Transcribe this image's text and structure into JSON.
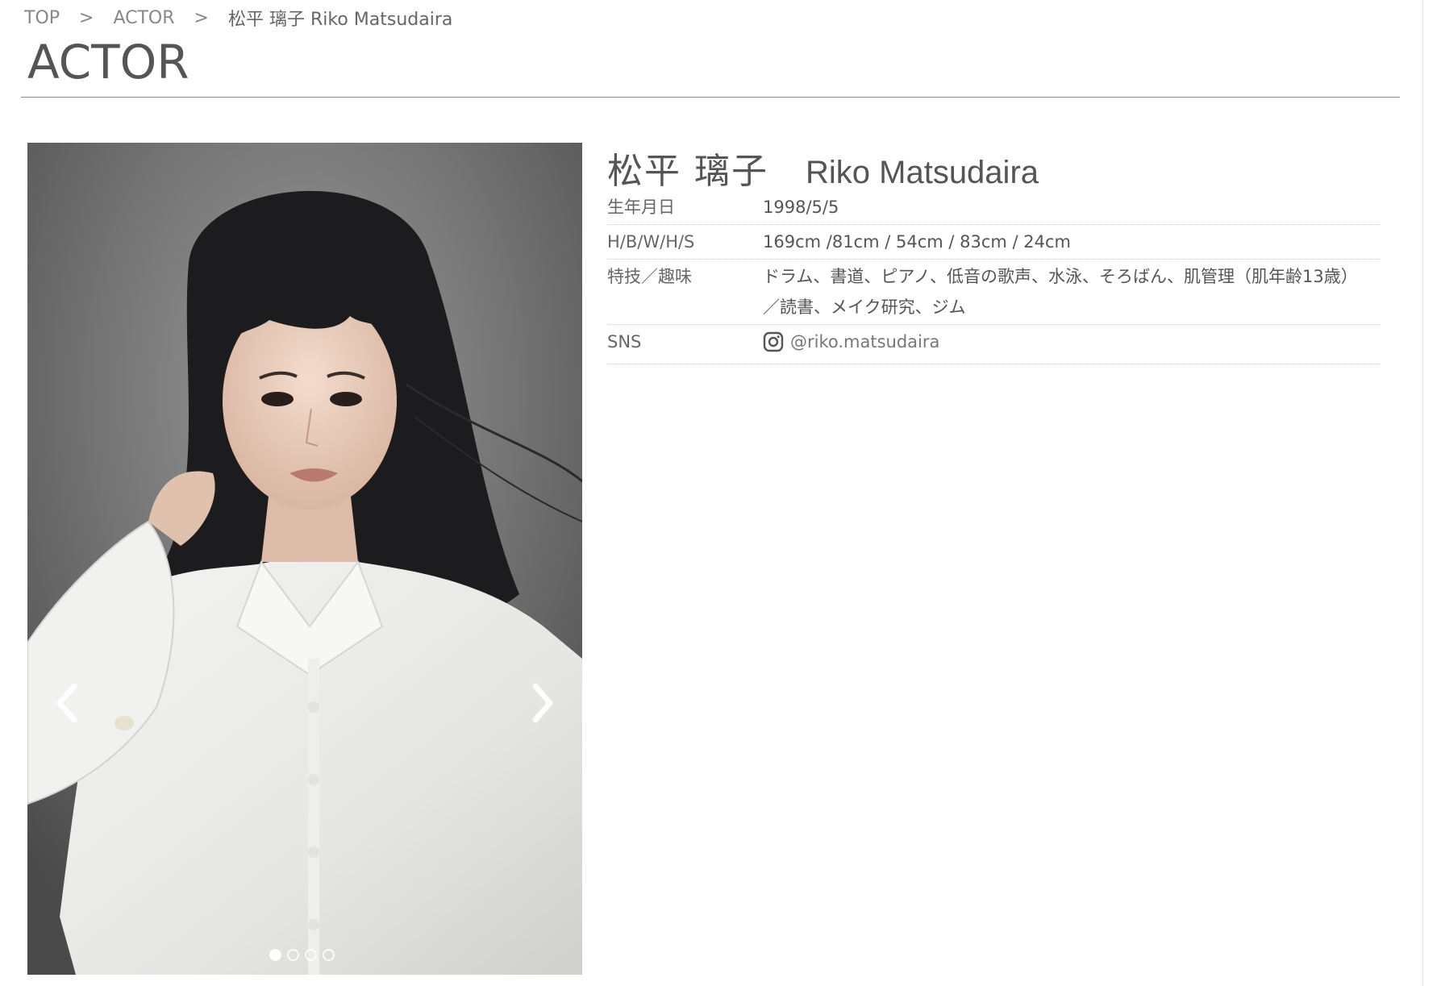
{
  "breadcrumb": {
    "items": [
      {
        "label": "TOP"
      },
      {
        "label": "ACTOR"
      },
      {
        "label": "松平 璃子 Riko Matsudaira"
      }
    ],
    "separator": ">"
  },
  "page_title": "ACTOR",
  "carousel": {
    "prev_icon": "chevron-left-icon",
    "next_icon": "chevron-right-icon",
    "slide_count": 4,
    "active_index": 0
  },
  "profile": {
    "name_jp": "松平 璃子",
    "name_en": "Riko Matsudaira",
    "rows": [
      {
        "label": "生年月日",
        "value": "1998/5/5"
      },
      {
        "label": "H/B/W/H/S",
        "value": "169cm /81cm / 54cm / 83cm / 24cm"
      },
      {
        "label": "特技／趣味",
        "value_lines": [
          "ドラム、書道、ピアノ、低音の歌声、水泳、そろばん、肌管理（肌年齢13歳）",
          "／読書、メイク研究、ジム"
        ]
      },
      {
        "label": "SNS",
        "value": "@riko.matsudaira",
        "icon": "instagram-icon"
      }
    ]
  },
  "colors": {
    "text": "#555555",
    "muted": "#888888",
    "rule": "#8a8a8a"
  }
}
